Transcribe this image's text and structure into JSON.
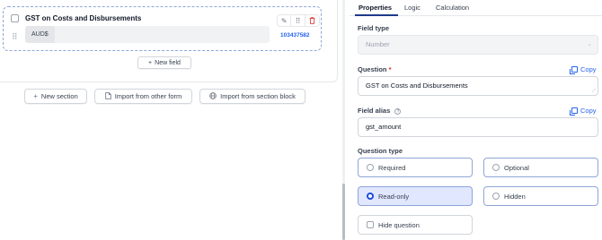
{
  "field": {
    "title": "GST on Costs and Disbursements",
    "prefix": "AUD$",
    "id": "103437582"
  },
  "builder": {
    "new_field_label": "New field",
    "new_section_label": "New section",
    "import_form_label": "Import from other form",
    "import_block_label": "Import from section block"
  },
  "tabs": {
    "properties": "Properties",
    "logic": "Logic",
    "calculation": "Calculation"
  },
  "properties": {
    "field_type_label": "Field type",
    "field_type_value": "Number",
    "question_label": "Question",
    "question_required_mark": "*",
    "question_value": "GST on Costs and Disbursements",
    "copy_label": "Copy",
    "alias_label": "Field alias",
    "alias_help": "?",
    "alias_value": "gst_amount",
    "question_type_label": "Question type",
    "options": {
      "required": "Required",
      "optional": "Optional",
      "read_only": "Read-only",
      "hidden": "Hidden"
    },
    "selected_option": "Read-only",
    "hide_question_label": "Hide question"
  },
  "colors": {
    "accent": "#1d4ed8",
    "link": "#2563eb",
    "danger": "#dc2626",
    "selected_bg": "#e0e7ff"
  },
  "icons": [
    "checkbox-icon",
    "drag-handle-icon",
    "pencil-icon",
    "grid-icon",
    "trash-icon",
    "plus-icon",
    "document-icon",
    "globe-icon",
    "copy-icon",
    "help-icon",
    "chevron-down-icon"
  ]
}
